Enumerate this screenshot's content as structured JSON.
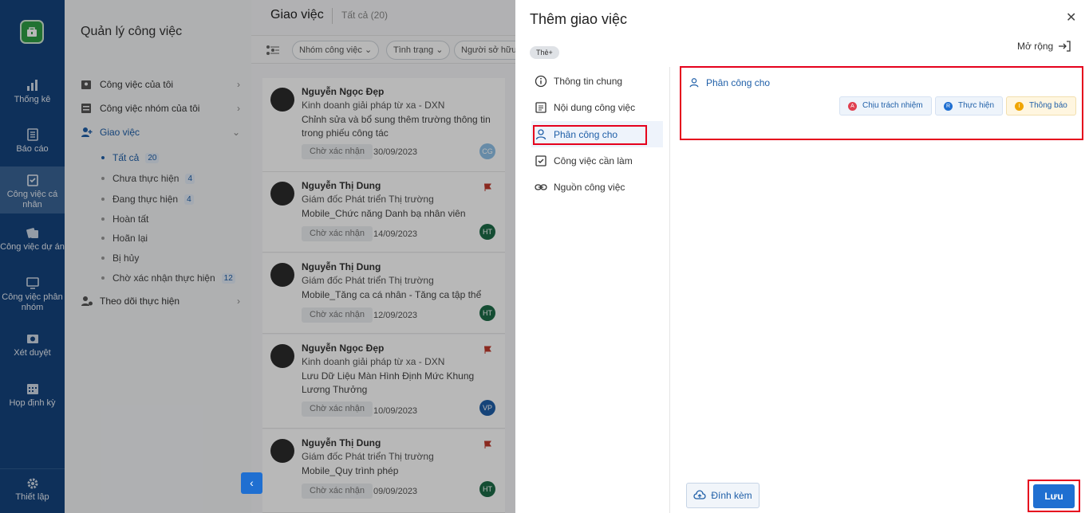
{
  "rail": {
    "items": [
      {
        "label": "Thống kê",
        "icon": "bar-chart-icon"
      },
      {
        "label": "Báo cáo",
        "icon": "report-icon"
      },
      {
        "label": "Công việc cá nhân",
        "icon": "personal-task-icon"
      },
      {
        "label": "Công việc dự án",
        "icon": "project-task-icon"
      },
      {
        "label": "Công việc phân nhóm",
        "icon": "group-task-icon"
      },
      {
        "label": "Xét duyệt",
        "icon": "approval-icon"
      },
      {
        "label": "Họp định kỳ",
        "icon": "calendar-icon"
      },
      {
        "label": "Thiết lập",
        "icon": "gear-icon"
      }
    ]
  },
  "sidebar": {
    "title": "Quản lý công việc",
    "my_tasks": "Công việc của tôi",
    "group_tasks": "Công việc nhóm của tôi",
    "assigned": "Giao việc",
    "children": [
      {
        "label": "Tất cả",
        "count": "20"
      },
      {
        "label": "Chưa thực hiện",
        "count": "4"
      },
      {
        "label": "Đang thực hiện",
        "count": "4"
      },
      {
        "label": "Hoàn tất",
        "count": ""
      },
      {
        "label": "Hoãn lại",
        "count": ""
      },
      {
        "label": "Bị hủy",
        "count": ""
      },
      {
        "label": "Chờ xác nhận thực hiện",
        "count": "12"
      }
    ],
    "follow": "Theo dõi thực hiện"
  },
  "list": {
    "title": "Giao việc",
    "subtitle": "Tất cả (20)",
    "filters": [
      "Nhóm công việc",
      "Tình trạng",
      "Người sở hữu"
    ],
    "cards": [
      {
        "name": "Nguyễn Ngọc Đẹp",
        "role": "Kinh doanh giải pháp từ xa - DXN",
        "title": "Chỉnh sửa và bổ sung thêm trường thông tin trong phiếu công tác",
        "status": "Chờ xác nhận",
        "date": "30/09/2023",
        "initials": "CG"
      },
      {
        "name": "Nguyễn Thị Dung",
        "role": "Giám đốc Phát triển Thị trường",
        "title": "Mobile_Chức năng Danh bạ nhân viên",
        "status": "Chờ xác nhận",
        "date": "14/09/2023",
        "initials": "HT"
      },
      {
        "name": "Nguyễn Thị Dung",
        "role": "Giám đốc Phát triển Thị trường",
        "title": "Mobile_Tăng ca cá nhân - Tăng ca tập thể",
        "status": "Chờ xác nhận",
        "date": "12/09/2023",
        "initials": "HT"
      },
      {
        "name": "Nguyễn Ngọc Đẹp",
        "role": "Kinh doanh giải pháp từ xa - DXN",
        "title": "Lưu Dữ Liệu Màn Hình Định Mức Khung Lương Thưởng",
        "status": "Chờ xác nhận",
        "date": "10/09/2023",
        "initials": "VP"
      },
      {
        "name": "Nguyễn Thị Dung",
        "role": "Giám đốc Phát triển Thị trường",
        "title": "Mobile_Quy trình phép",
        "status": "Chờ xác nhận",
        "date": "09/09/2023",
        "initials": "HT"
      }
    ]
  },
  "panel": {
    "title": "Thêm giao việc",
    "expand": "Mở rộng",
    "tag": "Thẻ+",
    "nav": [
      "Thông tin chung",
      "Nội dung công việc",
      "Phân công cho",
      "Công việc cần làm",
      "Nguồn công việc"
    ],
    "assign_heading": "Phân công cho",
    "chips": [
      {
        "badge": "A",
        "label": "Chịu trách nhiệm"
      },
      {
        "badge": "R",
        "label": "Thực hiện"
      },
      {
        "badge": "I",
        "label": "Thông báo"
      }
    ],
    "attach": "Đính kèm",
    "save": "Lưu"
  },
  "colors": {
    "rail": "#14437d",
    "accent": "#1f6fd1",
    "highlight": "#e5001c"
  }
}
